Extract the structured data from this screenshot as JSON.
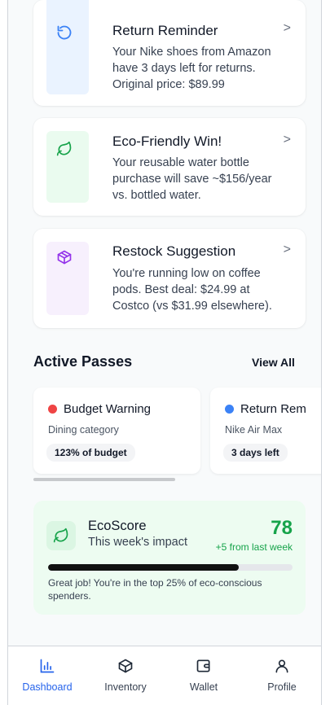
{
  "colors": {
    "accent": "#2563eb",
    "eco_green": "#16a34a",
    "warning_red": "#ef4444",
    "info_blue": "#3b82f6"
  },
  "notifications": [
    {
      "title": "Return Reminder",
      "body": "Your Nike shoes from Amazon have 3 days left for returns. Original price: $89.99",
      "icon": "rotate-ccw-icon",
      "tint": "#eaf3ff",
      "icon_color": "#3b82f6"
    },
    {
      "title": "Eco-Friendly Win!",
      "body": "Your reusable water bottle purchase will save ~$156/year vs. bottled water.",
      "icon": "leaf-icon",
      "tint": "#eafbef",
      "icon_color": "#16a34a"
    },
    {
      "title": "Restock Suggestion",
      "body": "You're running low on coffee pods. Best deal: $24.99 at Costco (vs $31.99 elsewhere).",
      "icon": "package-icon",
      "tint": "#f7f0fd",
      "icon_color": "#9333ea"
    }
  ],
  "chevron": ">",
  "active_passes": {
    "title": "Active Passes",
    "view_all": "View All",
    "passes": [
      {
        "title": "Budget Warning",
        "subtitle": "Dining category",
        "badge": "123% of budget",
        "dot": "#ef4444"
      },
      {
        "title": "Return Rem",
        "subtitle": "Nike Air Max",
        "badge": "3 days left",
        "dot": "#3b82f6"
      }
    ]
  },
  "ecoscore": {
    "title": "EcoScore",
    "subtitle": "This week's impact",
    "score": "78",
    "delta": "+5 from last week",
    "progress": 0.78,
    "note": "Great job! You're in the top 25% of eco-conscious spenders."
  },
  "nav": {
    "items": [
      {
        "label": "Dashboard",
        "icon": "bar-chart-icon",
        "active": true
      },
      {
        "label": "Inventory",
        "icon": "box-icon",
        "active": false
      },
      {
        "label": "Wallet",
        "icon": "wallet-icon",
        "active": false
      },
      {
        "label": "Profile",
        "icon": "user-icon",
        "active": false
      }
    ]
  }
}
